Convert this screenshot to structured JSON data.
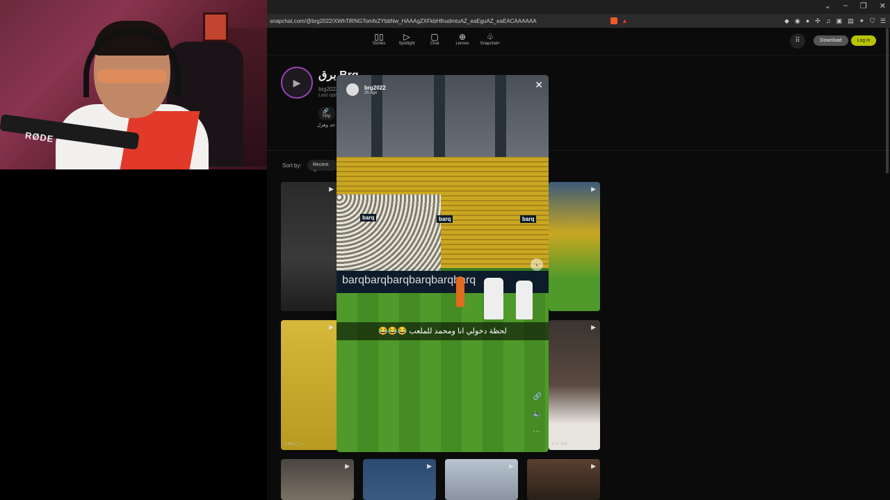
{
  "webcam": {
    "mic_brand": "RØDE"
  },
  "browser": {
    "url": "snapchat.com/@brg2022/XWhTiRNGTomfxZYbbNw_HAAAgZXFkbHlhudmtuAZ_eaEguAZ_eaEACAAAAAA",
    "window_controls": [
      "⌄",
      "–",
      "❐",
      "✕"
    ],
    "buttons": {
      "download": "Download",
      "login": "Log in"
    }
  },
  "nav": [
    {
      "label": "Stories",
      "icon": "stories-icon"
    },
    {
      "label": "Spotlight",
      "icon": "spotlight-icon"
    },
    {
      "label": "Chat",
      "icon": "chat-icon"
    },
    {
      "label": "Lenses",
      "icon": "lenses-icon"
    },
    {
      "label": "Snapchat+",
      "icon": "ghost-icon"
    }
  ],
  "profile": {
    "name": "برق Brg",
    "username": "brg2022",
    "updated": "Last upd",
    "link": "http",
    "bio": "جد وهزل"
  },
  "sort": {
    "label": "Sort by:",
    "value": "Recent"
  },
  "tiles": [
    {
      "stats": ""
    },
    {
      "stats": ""
    },
    {
      "stats": "4.5%  ◯ 1"
    },
    {
      "stats": "5  ✈ 108"
    }
  ],
  "modal": {
    "user": "brg2022",
    "time": "2h ago",
    "caption": "لحظة دخولي انا ومحمد للملعب 😂😂😂",
    "board_words": [
      "barq",
      "barq",
      "barq",
      "barq",
      "barq",
      "barq"
    ],
    "stand_signs": [
      "barq",
      "barq",
      "barq"
    ]
  },
  "colors": {
    "accent": "#b9c400",
    "avatar_ring": "#9b43b5",
    "pitch": "#4f9a2a"
  }
}
